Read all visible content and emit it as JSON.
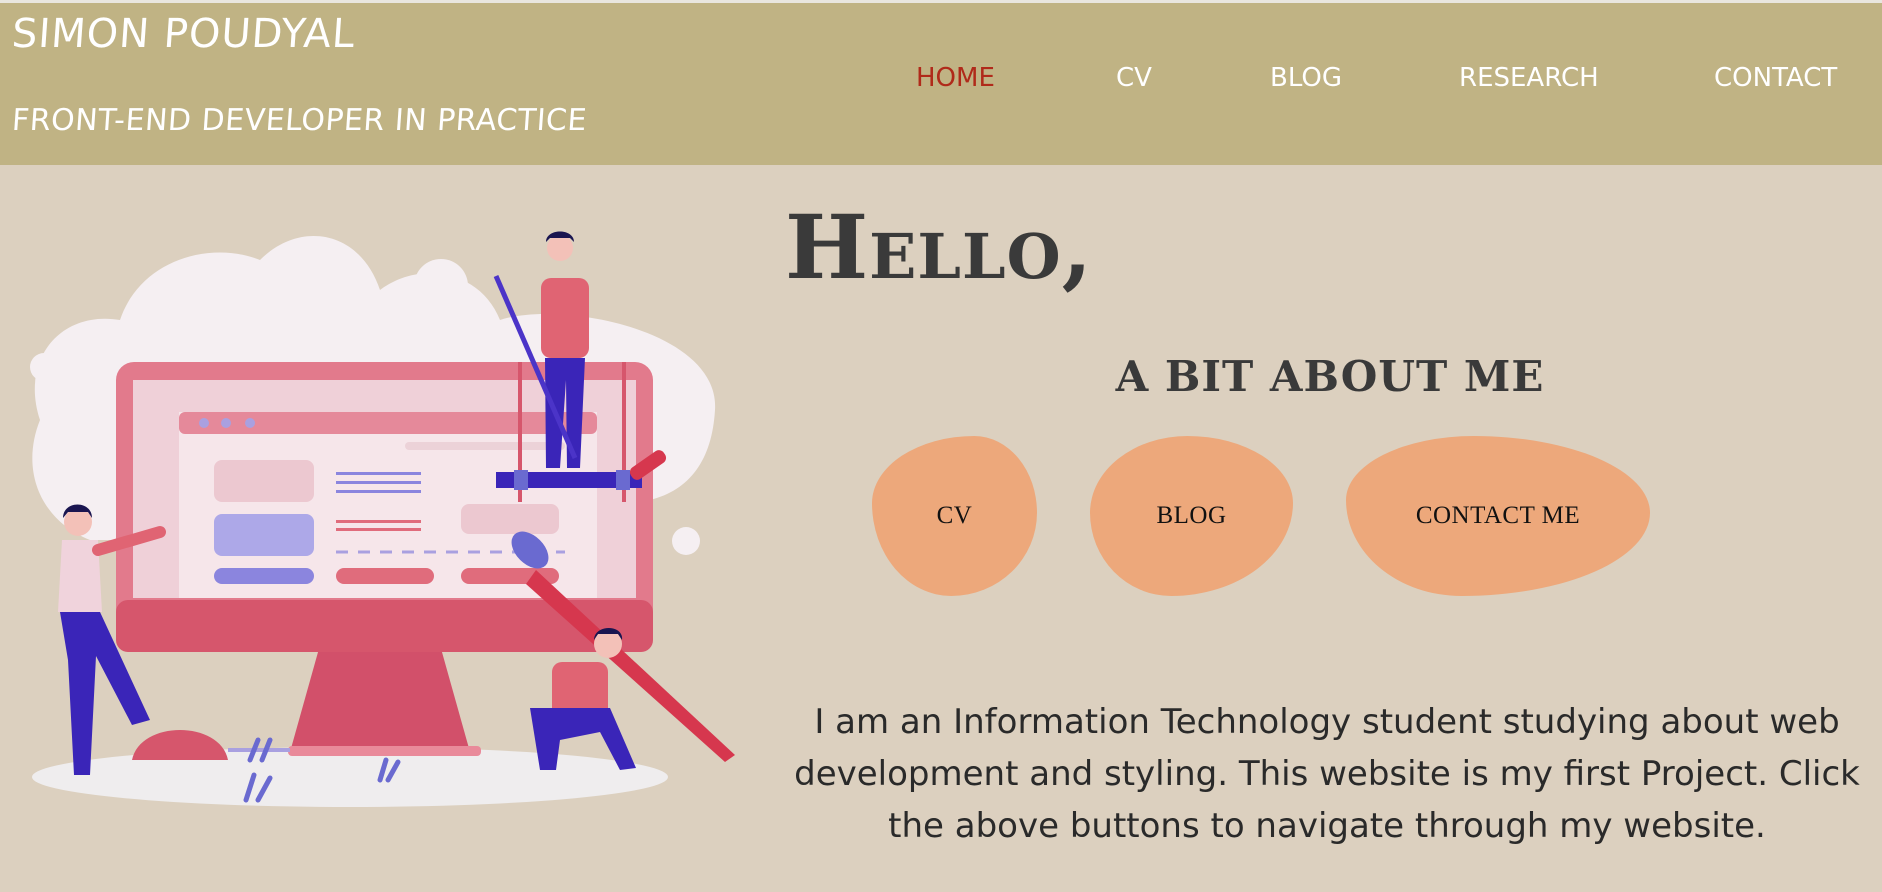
{
  "header": {
    "site_name": "SIMON POUDYAL",
    "tagline": "FRONT-END DEVELOPER IN PRACTICE"
  },
  "nav": {
    "items": [
      {
        "label": "HOME",
        "active": true
      },
      {
        "label": "CV",
        "active": false
      },
      {
        "label": "BLOG",
        "active": false
      },
      {
        "label": "RESEARCH",
        "active": false
      },
      {
        "label": "CONTACT",
        "active": false
      }
    ],
    "active_color": "#b02a1a"
  },
  "main": {
    "greeting": "Hello,",
    "about_heading": "A BIT ABOUT ME",
    "buttons": {
      "cv": "CV",
      "blog": "BLOG",
      "contact": "CONTACT ME"
    },
    "intro": "I am an Information Technology student studying about web development and styling. This website is my first Project. Click the above buttons to navigate through my website."
  },
  "colors": {
    "header_bg": "#c0b384",
    "page_bg": "#dcd0bf",
    "button_bg": "#eda87b",
    "text_dark": "#3a3a3a"
  },
  "illustration": {
    "icon": "web-development-team-illustration"
  }
}
